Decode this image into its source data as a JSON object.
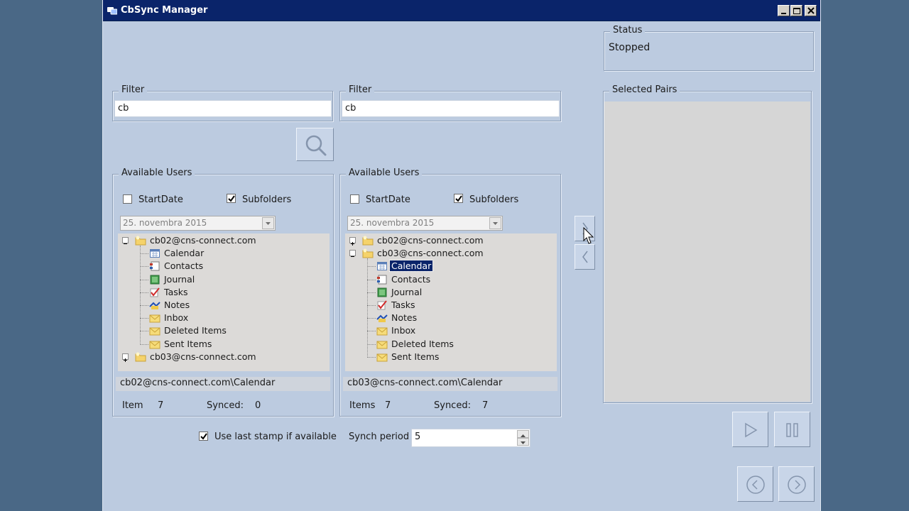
{
  "window": {
    "title": "CbSync Manager"
  },
  "status": {
    "group_label": "Status",
    "value": "Stopped"
  },
  "left_panel": {
    "filter_label": "Filter",
    "filter_value": "cb",
    "users_label": "Available Users",
    "startdate_label": "StartDate",
    "startdate_checked": false,
    "subfolders_label": "Subfolders",
    "subfolders_checked": true,
    "date_value": "25.  novembra 2015",
    "tree": [
      {
        "label": "cb02@cns-connect.com",
        "type": "account",
        "expanded": true
      },
      {
        "label": "Calendar",
        "type": "calendar"
      },
      {
        "label": "Contacts",
        "type": "contacts"
      },
      {
        "label": "Journal",
        "type": "journal"
      },
      {
        "label": "Tasks",
        "type": "tasks"
      },
      {
        "label": "Notes",
        "type": "notes"
      },
      {
        "label": "Inbox",
        "type": "mail"
      },
      {
        "label": "Deleted Items",
        "type": "mail"
      },
      {
        "label": "Sent Items",
        "type": "mail"
      },
      {
        "label": "cb03@cns-connect.com",
        "type": "account",
        "expanded": false
      }
    ],
    "path": "cb02@cns-connect.com\\Calendar",
    "items_label": "Item",
    "items_value": "7",
    "synced_label": "Synced:",
    "synced_value": "0"
  },
  "right_panel": {
    "filter_label": "Filter",
    "filter_value": "cb",
    "users_label": "Available Users",
    "startdate_label": "StartDate",
    "startdate_checked": false,
    "subfolders_label": "Subfolders",
    "subfolders_checked": true,
    "date_value": "25.  novembra 2015",
    "tree": [
      {
        "label": "cb02@cns-connect.com",
        "type": "account",
        "expanded": false
      },
      {
        "label": "cb03@cns-connect.com",
        "type": "account",
        "expanded": true
      },
      {
        "label": "Calendar",
        "type": "calendar",
        "selected": true
      },
      {
        "label": "Contacts",
        "type": "contacts"
      },
      {
        "label": "Journal",
        "type": "journal"
      },
      {
        "label": "Tasks",
        "type": "tasks"
      },
      {
        "label": "Notes",
        "type": "notes"
      },
      {
        "label": "Inbox",
        "type": "mail"
      },
      {
        "label": "Deleted Items",
        "type": "mail"
      },
      {
        "label": "Sent Items",
        "type": "mail"
      }
    ],
    "path": "cb03@cns-connect.com\\Calendar",
    "items_label": "Items",
    "items_value": "7",
    "synced_label": "Synced:",
    "synced_value": "7"
  },
  "options": {
    "use_last_stamp_label": "Use last stamp if available",
    "use_last_stamp_checked": true,
    "synch_period_label": "Synch period [s]:",
    "synch_period_value": "5"
  },
  "selected_pairs": {
    "label": "Selected Pairs"
  },
  "icons": {
    "search": "search-icon",
    "add_pair": "chevron-right-icon",
    "remove_pair": "chevron-left-icon",
    "play": "play-icon",
    "pause": "pause-icon",
    "prev": "circle-left-icon",
    "next": "circle-right-icon"
  },
  "colors": {
    "window_bg": "#bccbe0",
    "titlebar": "#0a246a",
    "desktop": "#4a6886",
    "selection": "#0a246a"
  }
}
